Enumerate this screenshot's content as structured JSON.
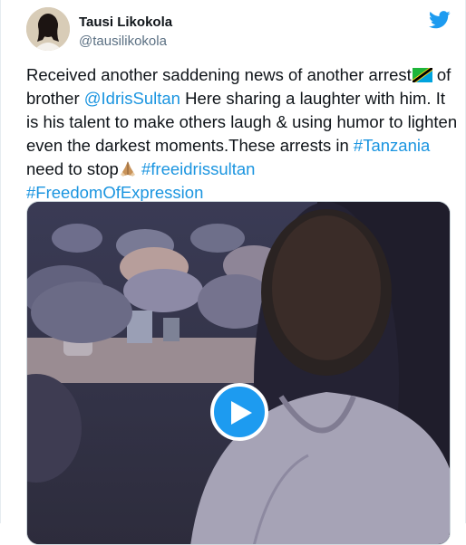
{
  "author": {
    "display_name": "Tausi Likokola",
    "handle": "@tausilikokola"
  },
  "tweet": {
    "text_part1": "Received another saddening news of another arrest",
    "text_part2": " of brother ",
    "mention": "@IdrisSultan",
    "text_part3": " Here sharing a laughter with him. It is his talent to make others laugh & using humor to lighten even the darkest moments.These arrests in ",
    "hashtag_tanzania": "#Tanzania",
    "text_part4": " need to stop",
    "hashtag_freeidris": "#freeidrissultan",
    "hashtag_freedom": "#FreedomOfExpression"
  },
  "icons": {
    "bird": "twitter-bird-icon",
    "flag": "tanzania-flag-emoji",
    "hands": "folded-hands-emoji",
    "play": "play-icon"
  },
  "colors": {
    "link": "#1b95e0",
    "twitter_blue": "#1d9bf0",
    "text": "#0f1419",
    "muted": "#5b7083"
  }
}
